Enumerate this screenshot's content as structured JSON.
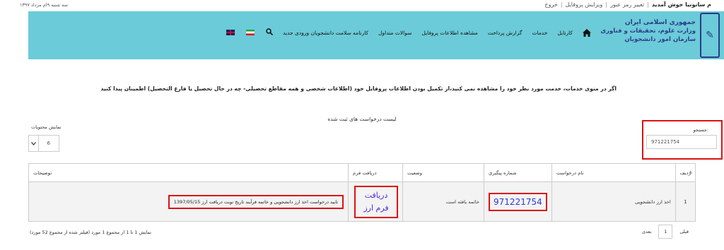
{
  "topbar": {
    "date": "سه شنبه ۹ام مرداد ۱۳۹۷",
    "welcome": "م سانونیا خوش آمدید",
    "change_password": "تغییر رمز عبور",
    "edit_profile": "ویرایش پروفایل",
    "logout": "خروج",
    "separator": "|"
  },
  "logo": {
    "line1": "جمهوری اسلامی ایران",
    "line2": "وزارت علوم، تحقیقات و فناوری",
    "line3": "سازمان امور دانشجویان"
  },
  "nav": {
    "items": [
      {
        "label": "کارتابل"
      },
      {
        "label": "خدمات"
      },
      {
        "label": "گزارش پرداخت"
      },
      {
        "label": "مشاهده اطلاعات پروفایل"
      },
      {
        "label": "سوالات متداول"
      },
      {
        "label": "کارنامه سلامت دانشجویان ورودی جدید"
      }
    ],
    "icons": [
      "home-icon",
      "search-icon",
      "iran-flag-icon",
      "uk-flag-icon"
    ]
  },
  "notice": "اگر در منوی خدمات، خدمت مورد نظر خود را مشاهده نمی کنید،از تکمیل بودن اطلاعات پروفایل خود (اطلاعات شخصی و همه مقاطع تحصیلی- چه در حال تحصیل یا فارغ التحصیل) اطمینان پیدا کنید",
  "list_title": "لیست درخواست های ثبت شده",
  "search": {
    "label": "جستجو:",
    "value": "971221754"
  },
  "page_size": {
    "label": "نمایش محتویات",
    "value": "6"
  },
  "table": {
    "headers": [
      "ردیف",
      "نام درخواست",
      "شماره پیگیری",
      "وضعیت",
      "دریافت فرم",
      "توضیحات"
    ],
    "rows": [
      {
        "row": "1",
        "name": "اخذ ارز دانشجویی",
        "tracking": "971221754",
        "status": "خاتمه یافته است",
        "get_form": "دریافت فرم ارز",
        "description": "تایید درخواست اخذ ارز دانشجویی و خاتمه فرآیند تاریخ نوبت دریافت ارز 1397/05/15"
      }
    ]
  },
  "footer": {
    "info": "نمایش 1 تا 1 از مجموع 1 مورد (فیلتر شده از مجموع 52 مورد)",
    "prev": "قبلی",
    "page": "1",
    "next": "بعدی"
  },
  "colors": {
    "header_bg": "#6bcbd8",
    "highlight": "#dd1111",
    "link": "#2b3ad8",
    "logo": "#2b3a8a"
  }
}
